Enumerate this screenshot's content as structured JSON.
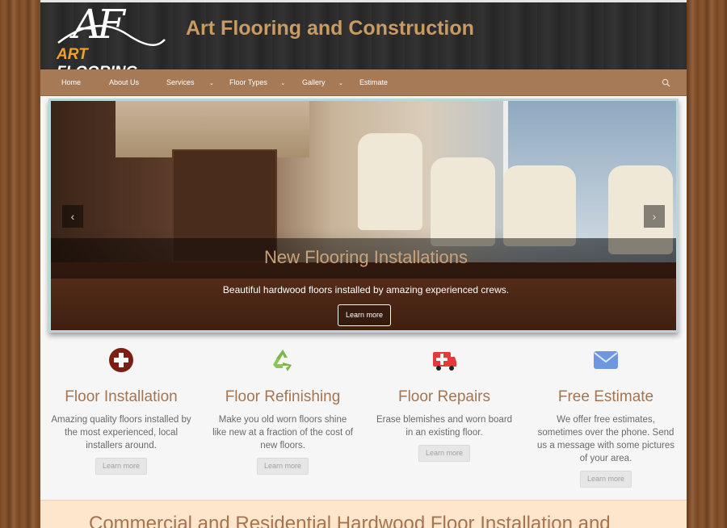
{
  "header": {
    "logo_mark": "AF",
    "logo_word_1": "ART",
    "logo_word_2": "FLOORING",
    "site_title": "Art Flooring and Construction"
  },
  "nav": {
    "items": [
      {
        "label": "Home",
        "has_dropdown": false
      },
      {
        "label": "About Us",
        "has_dropdown": false
      },
      {
        "label": "Services",
        "has_dropdown": true
      },
      {
        "label": "Floor Types",
        "has_dropdown": true
      },
      {
        "label": "Gallery",
        "has_dropdown": true
      },
      {
        "label": "Estimate",
        "has_dropdown": false
      }
    ],
    "caret": "⌄",
    "search_icon": "search-icon"
  },
  "slider": {
    "title": "New Flooring Installations",
    "text": "Beautiful hardwood floors installed by amazing experienced crews.",
    "button": "Learn more",
    "prev": "‹",
    "next": "›"
  },
  "features": [
    {
      "icon": "plus-circle-icon",
      "color": "#7b1f12",
      "title": "Floor Installation",
      "desc": "Amazing quality floors installed by the most experienced, local installers around.",
      "button": "Learn more"
    },
    {
      "icon": "recycle-icon",
      "color": "#7ab648",
      "title": "Floor Refinishing",
      "desc": "Make you old worn floors shine like new at a fraction of the cost of new floors.",
      "button": "Learn more"
    },
    {
      "icon": "ambulance-icon",
      "color": "#e23b3b",
      "title": "Floor Repairs",
      "desc": "Erase blemishes and worn board in an existing floor.",
      "button": "Learn more"
    },
    {
      "icon": "envelope-icon",
      "color": "#6f97e0",
      "title": "Free Estimate",
      "desc": "We offer free estimates, sometimes over the phone. Send us a message with some pictures of your area.",
      "button": "Learn more"
    }
  ],
  "banner": {
    "text": "Commercial and Residential Hardwood Floor Installation and"
  },
  "colors": {
    "accent": "#a57450",
    "nav_bg": "#a67a56",
    "header_bg": "#2d2d2d",
    "title": "#c99b63"
  }
}
